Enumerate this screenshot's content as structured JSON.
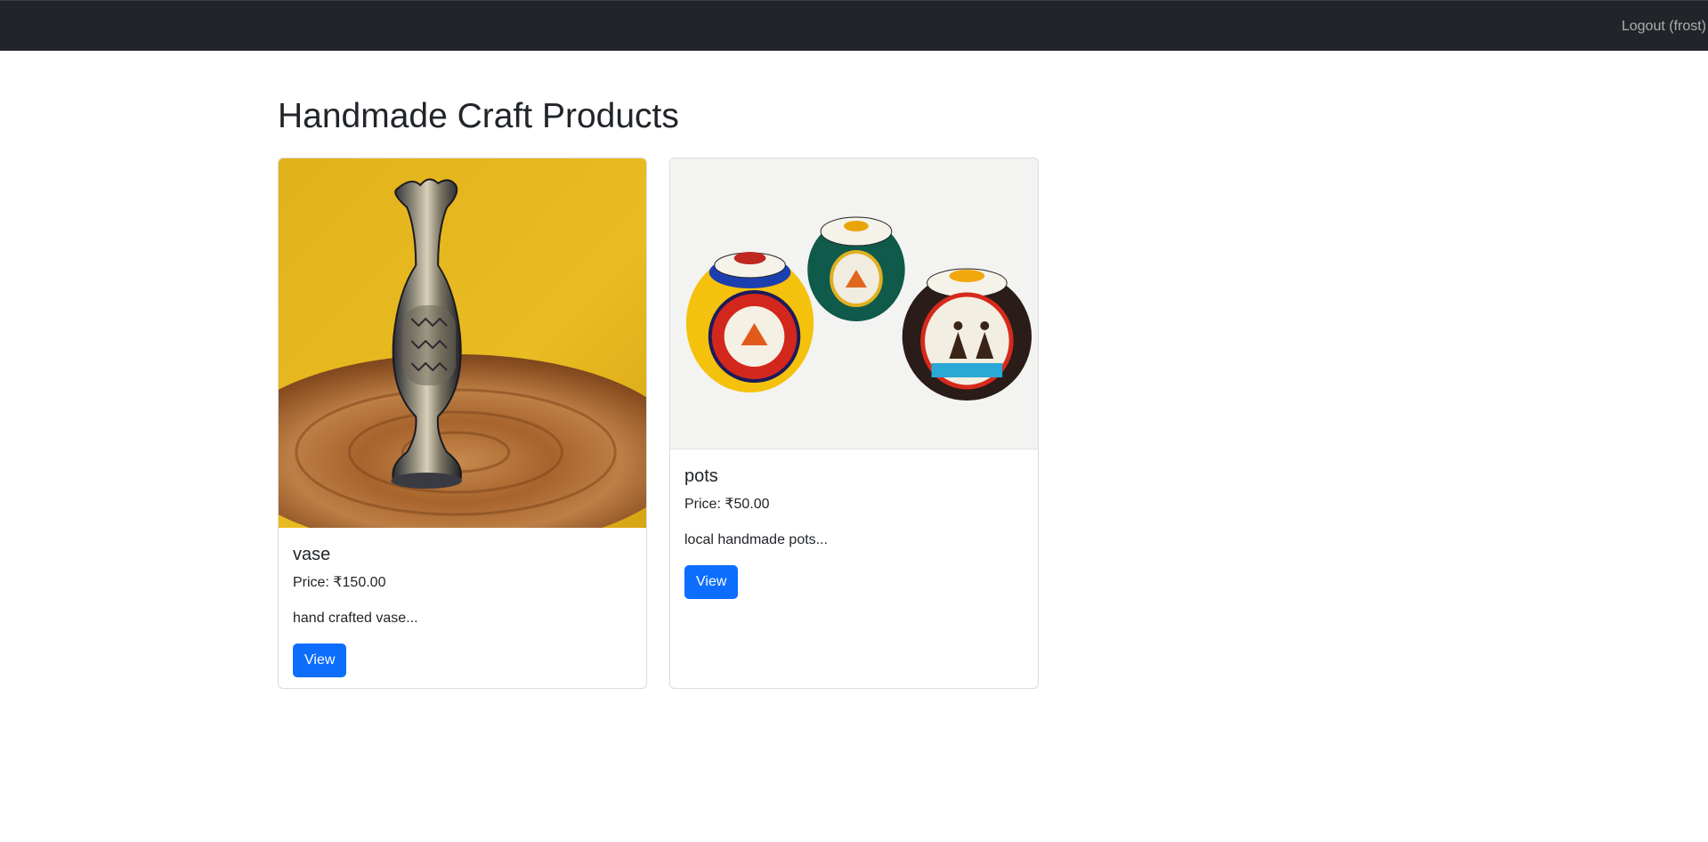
{
  "navbar": {
    "logout_label": "Logout (frost)",
    "background": "#212529"
  },
  "page": {
    "title": "Handmade Craft Products"
  },
  "products": [
    {
      "name": "vase",
      "price": "Price: ₹150.00",
      "description": "hand crafted vase...",
      "button_label": "View",
      "image": "brass-vase-photo"
    },
    {
      "name": "pots",
      "price": "Price: ₹50.00",
      "description": "local handmade pots...",
      "button_label": "View",
      "image": "painted-pots-photo"
    }
  ],
  "colors": {
    "primary": "#0d6efd",
    "text": "#212529"
  }
}
